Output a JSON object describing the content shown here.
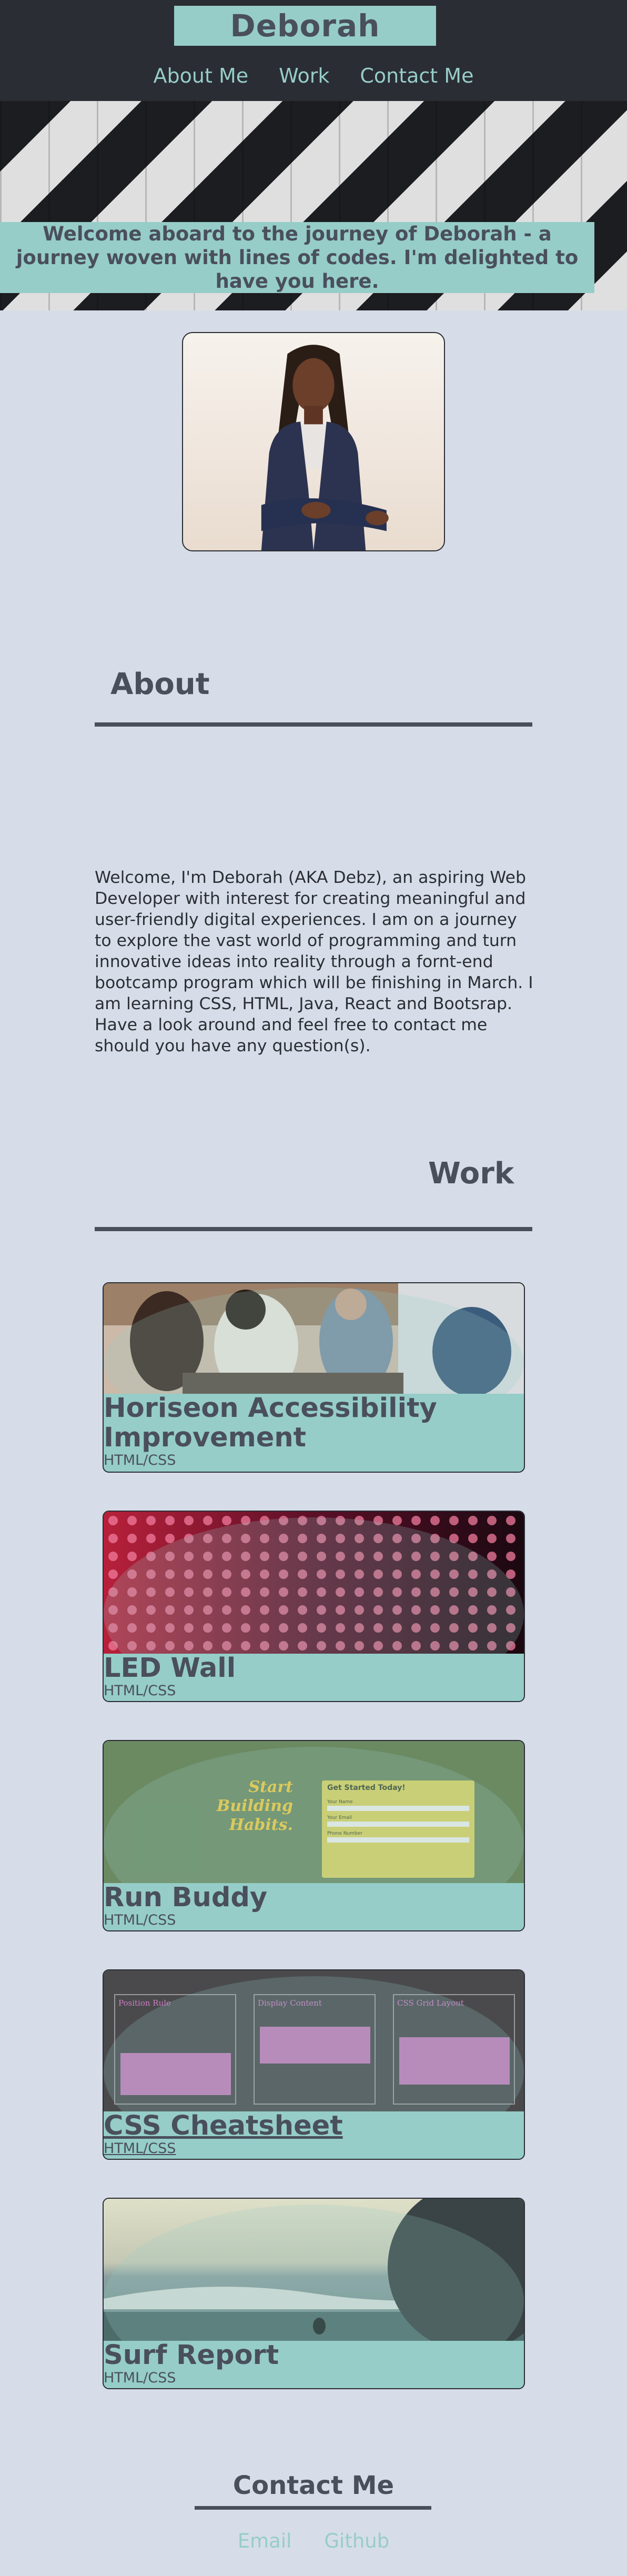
{
  "header": {
    "brand": "Deborah",
    "nav": [
      "About Me",
      "Work",
      "Contact Me"
    ]
  },
  "hero": {
    "banner": "Welcome aboard to the journey of Deborah - a journey woven with lines of codes. I'm delighted to have you here."
  },
  "about": {
    "title": "About",
    "text": "Welcome, I'm Deborah (AKA Debz), an aspiring Web Developer with interest for creating meaningful and user-friendly digital experiences. I am on a journey to explore the vast world of programming and turn innovative ideas into reality through a fornt-end bootcamp program which will be finishing in March. I am learning CSS, HTML, Java, React and Bootsrap. Have a look around and feel free to contact me should you have any question(s)."
  },
  "work": {
    "title": "Work",
    "projects": [
      {
        "title": "Horiseon Accessibility Improvement",
        "tech": "HTML/CSS"
      },
      {
        "title": "LED Wall",
        "tech": "HTML/CSS"
      },
      {
        "title": "Run Buddy",
        "tech": "HTML/CSS"
      },
      {
        "title": "CSS Cheatsheet",
        "tech": "HTML/CSS"
      },
      {
        "title": "Surf Report",
        "tech": "HTML/CSS"
      }
    ],
    "run_buddy_thumb": {
      "headline_1": "Start Building",
      "headline_2": "Habits.",
      "form_title": "Get Started Today!",
      "fields": [
        "Your Name",
        "Your Email",
        "Phone Number"
      ]
    },
    "css_thumb": {
      "columns": [
        "Position Rule",
        "Display Content",
        "CSS Grid Layout"
      ]
    }
  },
  "contact": {
    "title": "Contact Me",
    "links": [
      "Email",
      "Github"
    ]
  },
  "colors": {
    "accent": "#96cdc8",
    "header_bg": "#2b2d34",
    "page_bg": "#d6dde8",
    "text": "#4a4f5c"
  }
}
